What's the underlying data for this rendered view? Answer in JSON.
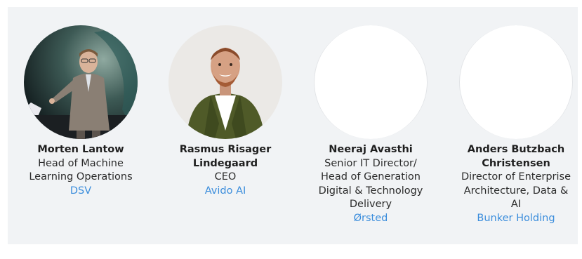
{
  "speakers": [
    {
      "name": "Morten Lantow",
      "title_lines": [
        "Head of Machine",
        "Learning Operations"
      ],
      "company": "DSV",
      "has_photo": true
    },
    {
      "name_lines": [
        "Rasmus Risager",
        "Lindegaard"
      ],
      "title": "CEO",
      "company": "Avido AI",
      "has_photo": true
    },
    {
      "name": "Neeraj Avasthi",
      "title_lines": [
        "Senior IT Director/",
        "Head of Generation",
        "Digital & Technology",
        "Delivery"
      ],
      "company": "Ørsted",
      "has_photo": false
    },
    {
      "name_lines": [
        "Anders Butzbach",
        "Christensen"
      ],
      "title_lines": [
        "Director of Enterprise",
        "Architecture, Data &",
        "AI"
      ],
      "company": "Bunker Holding",
      "has_photo": false
    }
  ],
  "colors": {
    "panel_bg": "#f1f3f5",
    "company_link": "#3b8ddc",
    "text": "#2b2b2b"
  }
}
